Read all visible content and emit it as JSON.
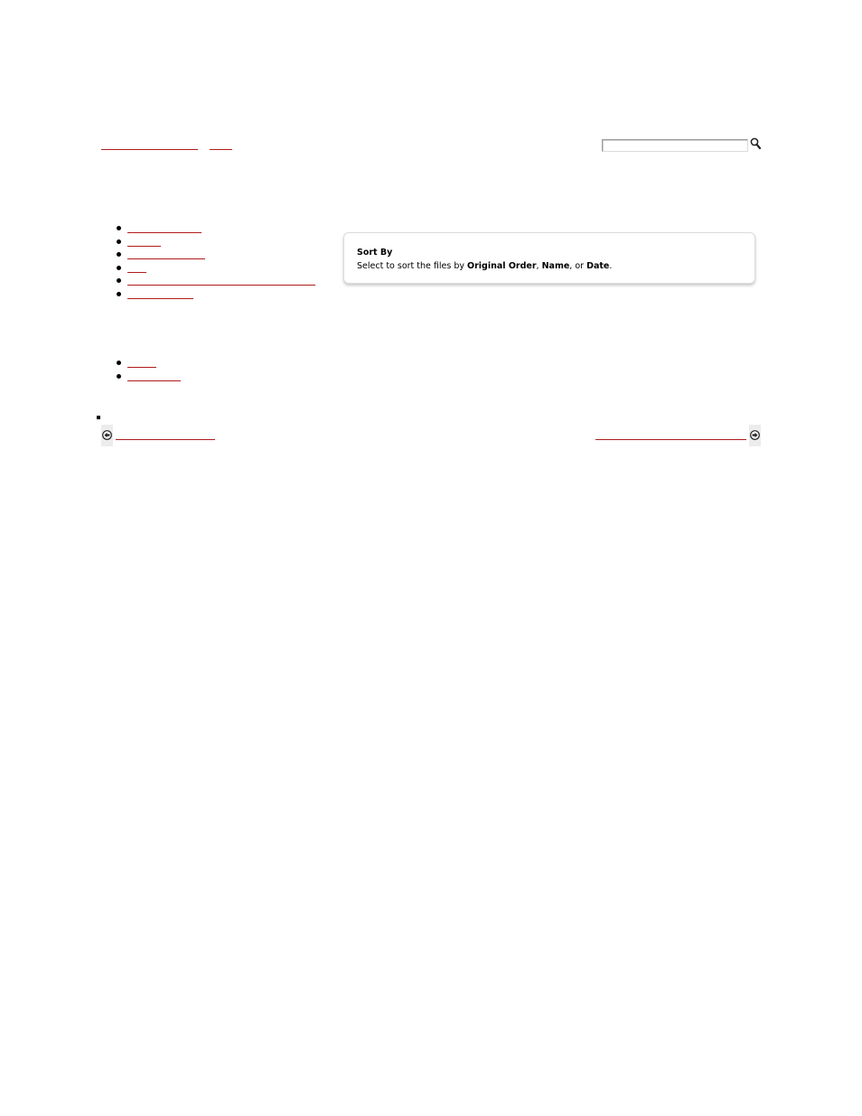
{
  "header": {
    "breadcrumb": [
      {
        "label": ""
      },
      {
        "label": ""
      }
    ],
    "search": {
      "value": "",
      "placeholder": "",
      "icon": "magnifier-icon"
    }
  },
  "sort_panel": {
    "title": "Sort By",
    "desc_prefix": "Select to sort the files by ",
    "option_1": "Original Order",
    "sep_1": ", ",
    "option_2": "Name",
    "sep_2": ", or ",
    "option_3": "Date",
    "desc_suffix": "."
  },
  "nav_list_1": [
    {
      "label": ""
    },
    {
      "label": ""
    },
    {
      "label": ""
    },
    {
      "label": ""
    },
    {
      "label": ""
    },
    {
      "label": ""
    }
  ],
  "nav_list_2": [
    {
      "label": ""
    },
    {
      "label": ""
    }
  ],
  "footer": {
    "prev": {
      "label": "",
      "icon": "arrow-left-circle-icon"
    },
    "next": {
      "label": "",
      "icon": "arrow-right-circle-icon"
    }
  },
  "colors": {
    "link": "#b01c1c",
    "panel_border": "#dcdcdc"
  }
}
